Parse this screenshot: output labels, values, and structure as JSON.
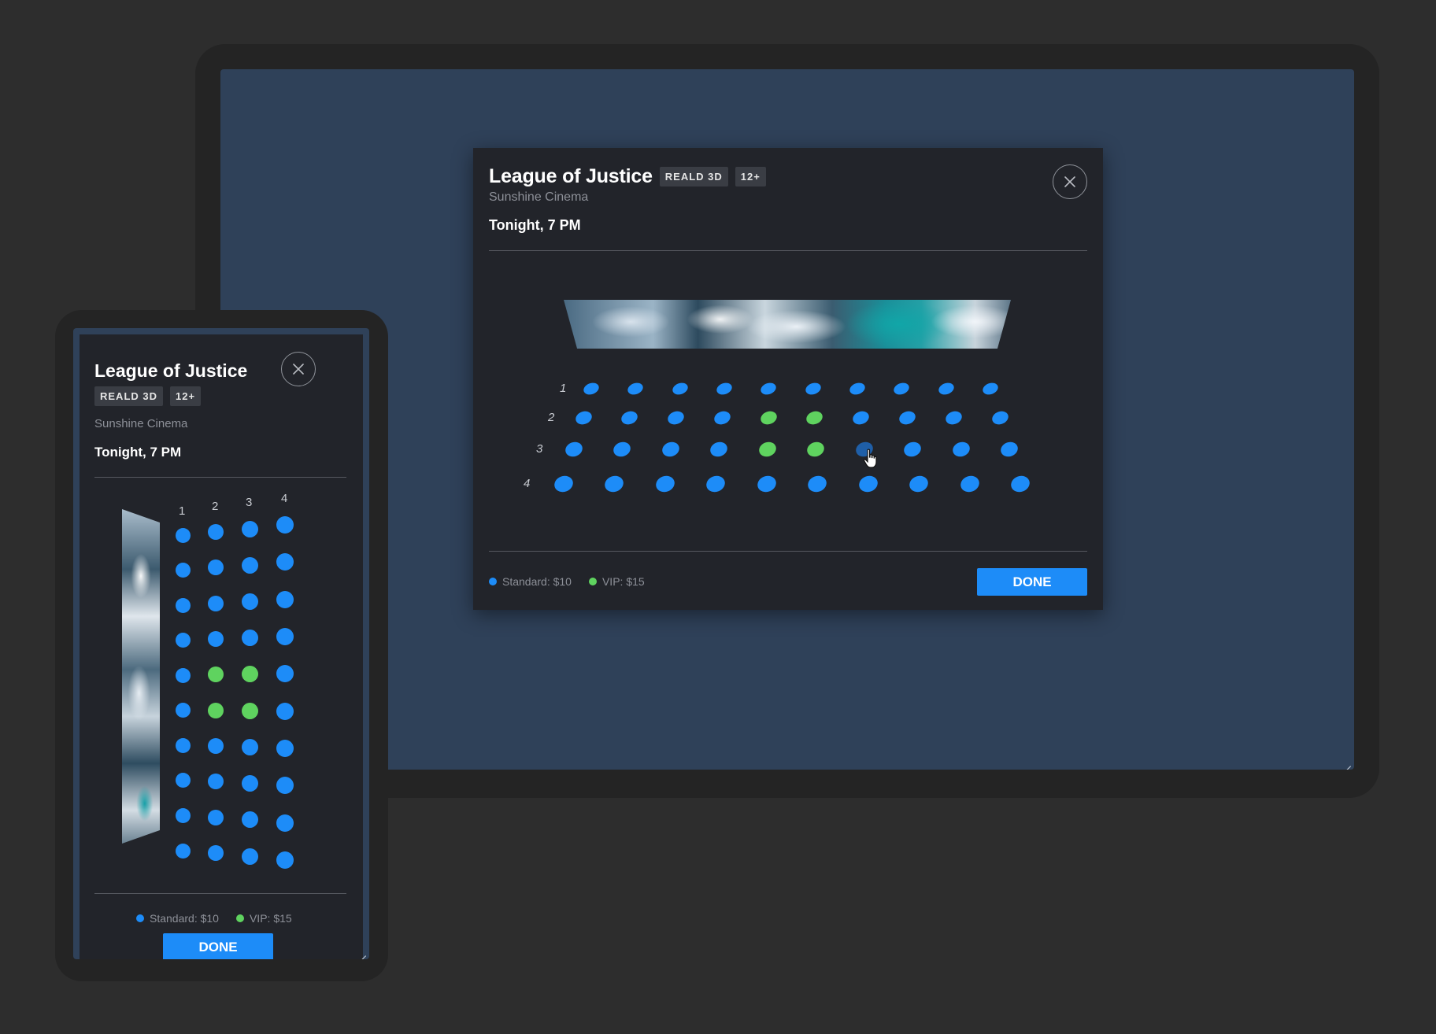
{
  "movie": {
    "title": "League of Justice",
    "badges": [
      "REALD 3D",
      "12+"
    ],
    "cinema": "Sunshine Cinema",
    "showtime": "Tonight, 7 PM"
  },
  "seating": {
    "rows": [
      "1",
      "2",
      "3",
      "4"
    ],
    "seats_per_row": 10,
    "layout": [
      [
        "standard",
        "standard",
        "standard",
        "standard",
        "standard",
        "standard",
        "standard",
        "standard",
        "standard",
        "standard"
      ],
      [
        "standard",
        "standard",
        "standard",
        "standard",
        "vip",
        "vip",
        "standard",
        "standard",
        "standard",
        "standard"
      ],
      [
        "standard",
        "standard",
        "standard",
        "standard",
        "vip",
        "vip",
        "hovered",
        "standard",
        "standard",
        "standard"
      ],
      [
        "standard",
        "standard",
        "standard",
        "standard",
        "standard",
        "standard",
        "standard",
        "standard",
        "standard",
        "standard"
      ]
    ]
  },
  "legend": {
    "standard": "Standard: $10",
    "vip": "VIP: $15"
  },
  "actions": {
    "done_label": "DONE"
  },
  "colors": {
    "standard_seat": "#1d8cf8",
    "vip_seat": "#5fd35f",
    "hovered_seat": "#1f5fa8",
    "accent": "#1d8cf8",
    "modal_bg": "#22242a",
    "screen_bg": "#2f4159"
  },
  "icons": {
    "close": "close-icon",
    "cursor": "hand-pointer-icon"
  }
}
